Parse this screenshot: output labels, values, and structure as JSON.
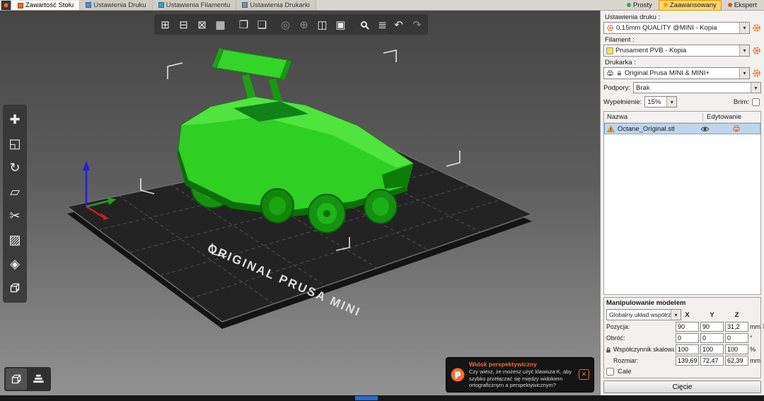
{
  "colors": {
    "accent_orange": "#ed6b21",
    "model_green": "#2fcf24",
    "mode_simple_green": "#43a047",
    "mode_advanced_orange": "#f5a300",
    "mode_expert_orange": "#e05a00",
    "filament_yellow": "#f6e34a",
    "selection_blue": "#bdd6ee"
  },
  "tabs": [
    {
      "label": "Zawartość Stołu"
    },
    {
      "label": "Ustawienia Druku"
    },
    {
      "label": "Ustawienia Filamentu"
    },
    {
      "label": "Ustawienia Drukarki"
    }
  ],
  "modes": [
    {
      "label": "Prosty"
    },
    {
      "label": "Zaawansowany"
    },
    {
      "label": "Ekspert"
    }
  ],
  "icons": {
    "add": "⊞",
    "delete": "⊟",
    "delete_all": "⊠",
    "arrange": "▦",
    "copy": "❐",
    "paste": "❏",
    "fill_bed": "◎",
    "add_instance": "⊕",
    "split_objects": "◫",
    "split_parts": "▣",
    "layers": "≣",
    "undo": "↶",
    "redo": "↷",
    "move": "✚",
    "scale": "◱",
    "rotate": "↻",
    "flatten": "▱",
    "cut": "✂",
    "supports": "▨",
    "seam": "◈",
    "dropdown": "▾",
    "close": "✕",
    "drop_to_bed": "↧"
  },
  "sidebar": {
    "print_settings_label": "Ustawienia druku :",
    "print_settings_value": "0.15mm QUALITY @MINI - Kopia",
    "filament_label": "Filament :",
    "filament_value": "Prusament PVB - Kopia",
    "printer_label": "Drukarka :",
    "printer_value": "Original Prusa MINI & MINI+",
    "supports_label": "Podpory:",
    "supports_value": "Brak",
    "infill_label": "Wypełnienie:",
    "infill_value": "15%",
    "brim_label": "Brim:",
    "list": {
      "col_name": "Nazwa",
      "col_edit": "Edytowanie",
      "row_name": "Octane_Original.stl"
    },
    "manipulation": {
      "title": "Manipulowanie modelem",
      "coord_system": "Globalny układ współrzę",
      "axis_x": "X",
      "axis_y": "Y",
      "axis_z": "Z",
      "rows": [
        {
          "label": "Pozycja:",
          "x": "90",
          "y": "90",
          "z": "31,2",
          "unit": "mm"
        },
        {
          "label": "Obróć:",
          "x": "0",
          "y": "0",
          "z": "0",
          "unit": "°"
        },
        {
          "label": "Współczynnik skalowania:",
          "x": "100",
          "y": "100",
          "z": "100",
          "unit": "%"
        },
        {
          "label": "Rozmiar:",
          "x": "139,69",
          "y": "72,47",
          "z": "62,39",
          "unit": "mm"
        }
      ],
      "inches_label": "Cale"
    },
    "slice_button": "Cięcie"
  },
  "viewport": {
    "bed_label": "ORIGINAL PRUSA MINI"
  },
  "notification": {
    "title": "Widok perspektywiczny",
    "body": "Czy wiesz, że możesz użyć klawisza K, aby szybko przełączać się między widokiem ortograficznym a perspektywicznym?"
  }
}
